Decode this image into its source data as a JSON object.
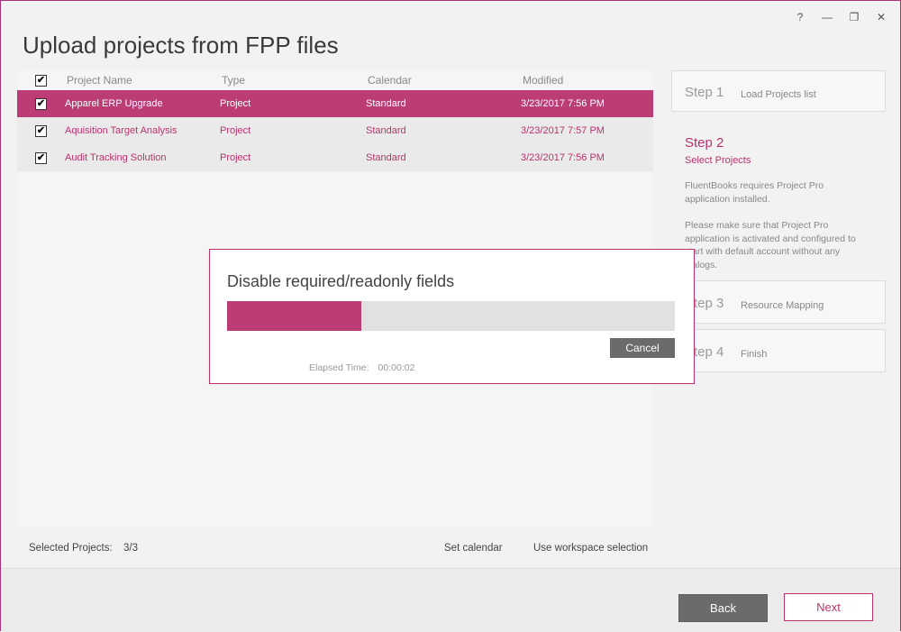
{
  "window": {
    "title": "Upload projects from FPP files",
    "controls": {
      "help": "?",
      "minimize": "—",
      "restore": "❐",
      "close": "✕"
    }
  },
  "grid": {
    "header_checked": true,
    "columns": [
      "Project Name",
      "Type",
      "Calendar",
      "Modified"
    ],
    "rows": [
      {
        "checked": true,
        "name": "Apparel ERP Upgrade",
        "type": "Project",
        "calendar": "Standard",
        "modified": "3/23/2017 7:56 PM",
        "selected": true
      },
      {
        "checked": true,
        "name": "Aquisition Target Analysis",
        "type": "Project",
        "calendar": "Standard",
        "modified": "3/23/2017 7:57 PM",
        "selected": false
      },
      {
        "checked": true,
        "name": "Audit Tracking Solution",
        "type": "Project",
        "calendar": "Standard",
        "modified": "3/23/2017 7:56 PM",
        "selected": false
      }
    ]
  },
  "steps": {
    "step1": {
      "num": "Step 1",
      "label": "Load Projects list"
    },
    "step2": {
      "num": "Step 2",
      "label": "Select Projects",
      "text1": "FluentBooks requires Project Pro application installed.",
      "text2": "Please make sure that Project Pro application is activated and configured to start with default account without any dialogs."
    },
    "step3": {
      "num": "Step 3",
      "label": "Resource Mapping"
    },
    "step4": {
      "num": "Step 4",
      "label": "Finish"
    }
  },
  "footer": {
    "selected_label": "Selected Projects:",
    "selected_value": "3/3",
    "set_calendar": "Set calendar",
    "use_workspace": "Use workspace selection"
  },
  "buttons": {
    "back": "Back",
    "next": "Next"
  },
  "dialog": {
    "title": "Disable required/readonly fields",
    "progress_percent": 30,
    "cancel": "Cancel",
    "elapsed_label": "Elapsed Time:",
    "elapsed_value": "00:00:02"
  },
  "colors": {
    "accent": "#bc3c76",
    "button_dark": "#6b6b6b"
  }
}
